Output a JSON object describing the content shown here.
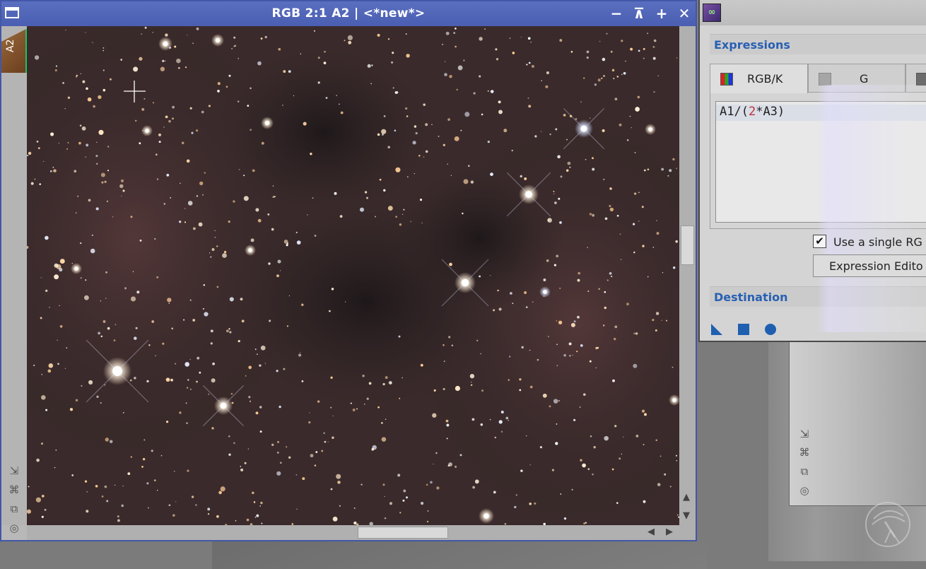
{
  "image_window": {
    "title": "RGB 2:1 A2 | <*new*>",
    "view_id": "A2",
    "icons": {
      "window": "window-icon",
      "minimize": "minimize-icon",
      "shade": "shade-icon",
      "maximize": "maximize-icon",
      "close": "close-icon"
    },
    "side_tools": [
      "resize-icon",
      "fit-view-icon",
      "clone-icon",
      "target-icon"
    ],
    "scroll": {
      "vertical_position": 0.41,
      "horizontal_position": 0.5
    }
  },
  "process_window": {
    "icon": "pixelmath-icon",
    "sections": {
      "expressions": "Expressions",
      "destination": "Destination"
    },
    "tabs": [
      {
        "label": "RGB/K",
        "icon": "rgb-swatch-icon",
        "active": true
      },
      {
        "label": "G",
        "icon": "gray-swatch-icon",
        "active": false
      }
    ],
    "expression": {
      "prefix": "A1/(",
      "number": "2",
      "suffix": "*A3)"
    },
    "single_rgb_checkbox": {
      "label": "Use a single RG",
      "checked": true
    },
    "expression_editor_button": "Expression Edito",
    "bottom_tools": [
      "new-instance-icon",
      "apply-square-icon",
      "apply-global-icon"
    ]
  },
  "background_window": {
    "tools": [
      "resize-icon",
      "fit-view-icon",
      "clone-icon",
      "target-icon"
    ]
  },
  "colors": {
    "title_bar": "#4a5eb2",
    "accent_text": "#2860b3",
    "view_tab": "#8a5a30",
    "view_tab_marker": "#19c463",
    "nebula_background": "#2e2324"
  }
}
